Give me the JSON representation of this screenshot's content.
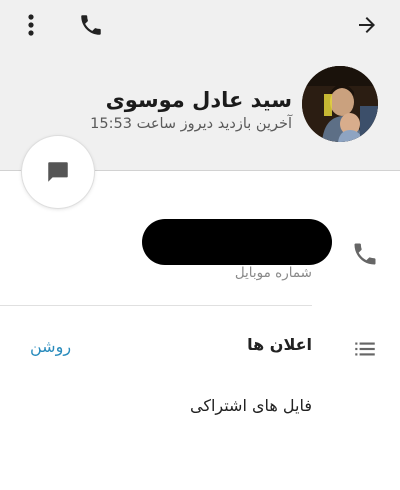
{
  "app_bar": {
    "menu_icon": "more-vert-icon",
    "call_icon": "phone-icon",
    "back_icon": "arrow-forward-icon",
    "background": "#f0f0f0"
  },
  "contact": {
    "name": "سید عادل موسوی",
    "last_seen": "آخرین بازدید دیروز ساعت 15:53",
    "avatar_icon": "profile-photo"
  },
  "fab": {
    "icon": "chat-bubble-icon"
  },
  "phone": {
    "icon": "phone-icon",
    "number_redacted": true,
    "caption": "شماره موبایل"
  },
  "notifications": {
    "icon": "list-icon",
    "label": "اعلان ها",
    "status": "روشن",
    "status_color": "#2a8cbd"
  },
  "shared_files": {
    "label": "فایل های اشتراکی"
  }
}
